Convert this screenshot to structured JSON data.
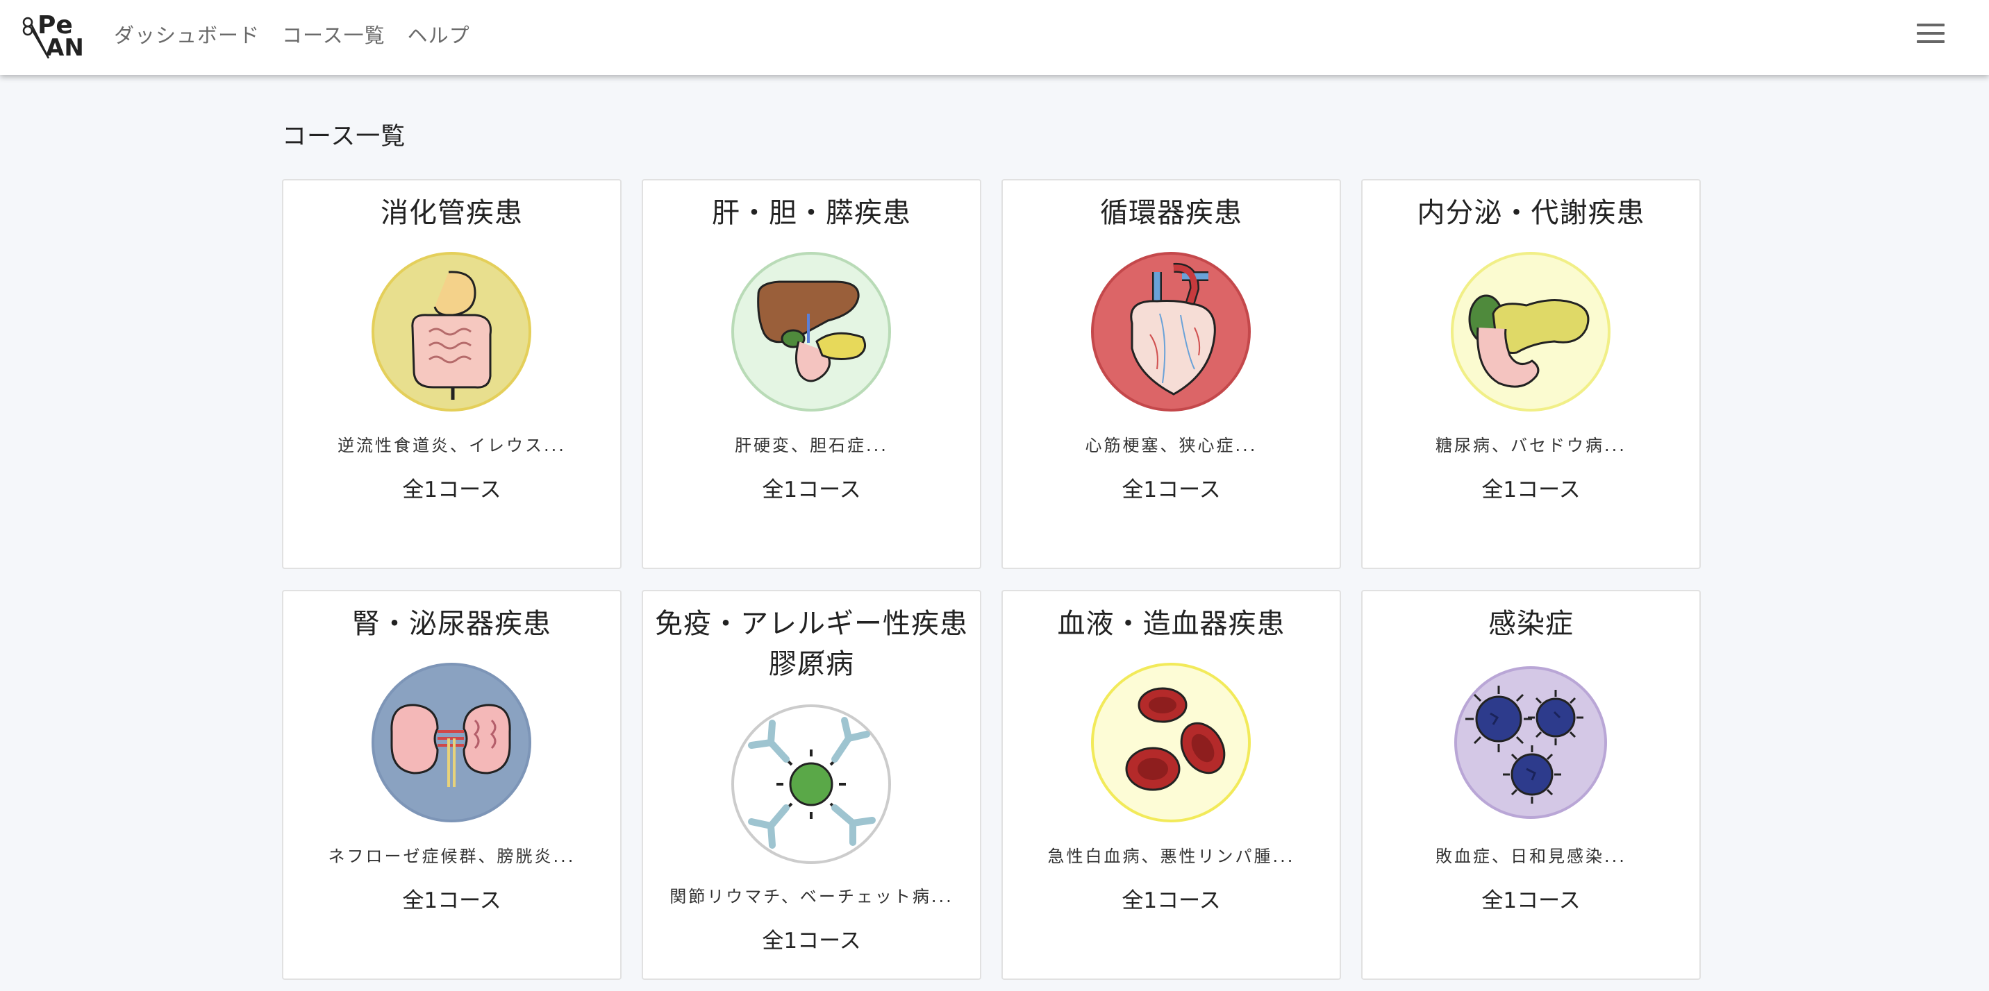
{
  "header": {
    "logo_text": "Pe AN",
    "nav": [
      "ダッシュボード",
      "コース一覧",
      "ヘルプ"
    ]
  },
  "page": {
    "title": "コース一覧"
  },
  "categories": [
    {
      "title": "消化管疾患",
      "desc": "逆流性食道炎、イレウス...",
      "count": "全1コース",
      "icon": "intestine-icon",
      "bg": "#e8df8e"
    },
    {
      "title": "肝・胆・膵疾患",
      "desc": "肝硬変、胆石症...",
      "count": "全1コース",
      "icon": "liver-icon",
      "bg": "#e4f5e3"
    },
    {
      "title": "循環器疾患",
      "desc": "心筋梗塞、狭心症...",
      "count": "全1コース",
      "icon": "heart-icon",
      "bg": "#dc6567"
    },
    {
      "title": "内分泌・代謝疾患",
      "desc": "糖尿病、バセドウ病...",
      "count": "全1コース",
      "icon": "pancreas-icon",
      "bg": "#fbfbd0"
    },
    {
      "title": "腎・泌尿器疾患",
      "desc": "ネフローゼ症候群、膀胱炎...",
      "count": "全1コース",
      "icon": "kidney-icon",
      "bg": "#8aa2c1"
    },
    {
      "title": "免疫・アレルギー性疾患／膠原病",
      "title_line1": "免疫・アレルギー性疾患／",
      "title_line2": "膠原病",
      "desc": "関節リウマチ、ベーチェット病...",
      "count": "全1コース",
      "icon": "antibody-icon",
      "bg": "#ffffff"
    },
    {
      "title": "血液・造血器疾患",
      "desc": "急性白血病、悪性リンパ腫...",
      "count": "全1コース",
      "icon": "blood-cell-icon",
      "bg": "#fdfcd6"
    },
    {
      "title": "感染症",
      "desc": "敗血症、日和見感染...",
      "count": "全1コース",
      "icon": "virus-icon",
      "bg": "#d4c8e6"
    }
  ]
}
